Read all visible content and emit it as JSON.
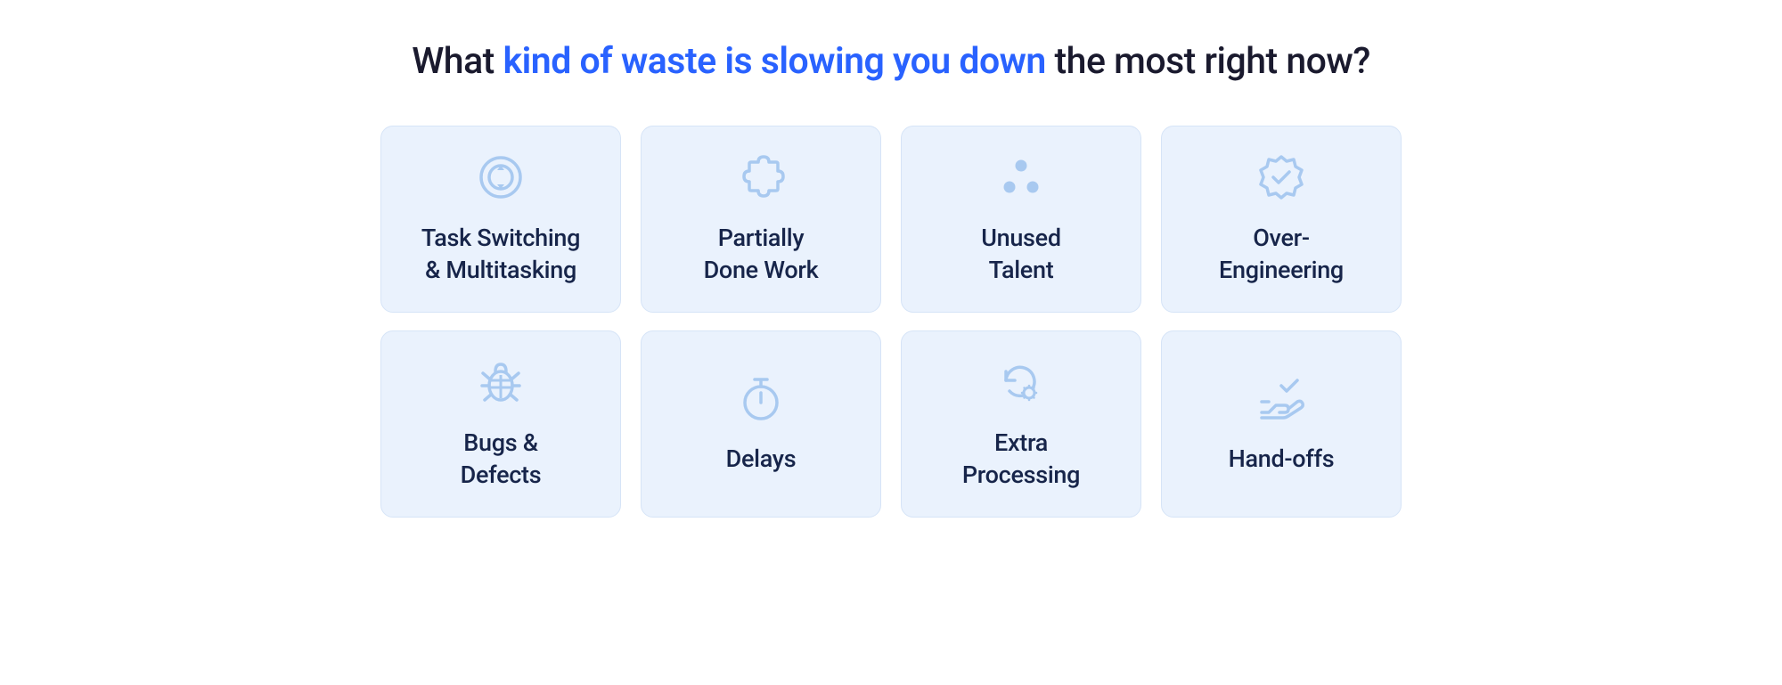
{
  "heading": {
    "prefix": "What ",
    "highlight": "kind of waste is slowing you down",
    "suffix": " the most right now?"
  },
  "cards": [
    {
      "icon": "refresh-circle",
      "label_line1": "Task Switching",
      "label_line2": "& Multitasking"
    },
    {
      "icon": "puzzle",
      "label_line1": "Partially",
      "label_line2": "Done Work"
    },
    {
      "icon": "dots",
      "label_line1": "Unused",
      "label_line2": "Talent"
    },
    {
      "icon": "badge-check",
      "label_line1": "Over-",
      "label_line2": "Engineering"
    },
    {
      "icon": "bug",
      "label_line1": "Bugs &",
      "label_line2": "Defects"
    },
    {
      "icon": "stopwatch",
      "label_line1": "Delays",
      "label_line2": ""
    },
    {
      "icon": "reprocess",
      "label_line1": "Extra",
      "label_line2": "Processing"
    },
    {
      "icon": "handshake",
      "label_line1": "Hand-offs",
      "label_line2": ""
    }
  ],
  "colors": {
    "icon": "#a8c9f0",
    "card_bg": "#eaf2fd",
    "card_border": "#d6e4f7",
    "text": "#17254a",
    "highlight": "#2962ff"
  }
}
